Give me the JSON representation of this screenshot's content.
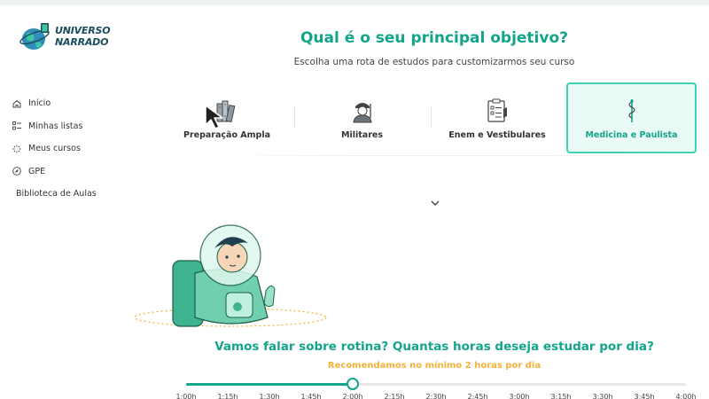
{
  "brand": {
    "line1": "Universo",
    "line2": "Narrado"
  },
  "sidebar": {
    "items": [
      {
        "label": "Início",
        "icon": "home-icon"
      },
      {
        "label": "Minhas listas",
        "icon": "list-icon"
      },
      {
        "label": "Meus cursos",
        "icon": "loader-icon"
      },
      {
        "label": "GPE",
        "icon": "compass-icon"
      },
      {
        "label": "Biblioteca de Aulas",
        "icon": ""
      }
    ]
  },
  "objective": {
    "title": "Qual é o seu principal objetivo?",
    "subtitle": "Escolha uma rota de estudos para customizarmos seu curso",
    "options": [
      {
        "label": "Preparação Ampla",
        "icon": "books-icon",
        "selected": false
      },
      {
        "label": "Militares",
        "icon": "soldier-icon",
        "selected": false
      },
      {
        "label": "Enem e Vestibulares",
        "icon": "checklist-icon",
        "selected": false
      },
      {
        "label": "Medicina e Paulista",
        "icon": "caduceus-icon",
        "selected": true
      }
    ]
  },
  "routine": {
    "title": "Vamos falar sobre rotina? Quantas horas deseja estudar por dia?",
    "recommendation": "Recomendamos no mínimo 2 horas por dia",
    "slider": {
      "value": "2:00h",
      "ticks": [
        "1:00h",
        "1:15h",
        "1:30h",
        "1:45h",
        "2:00h",
        "2:15h",
        "2:30h",
        "2:45h",
        "3:00h",
        "3:15h",
        "3:30h",
        "3:45h",
        "4:00h"
      ]
    }
  },
  "colors": {
    "accent": "#12a58a",
    "highlight": "#f7b13a",
    "selected_border": "#3dd2b5",
    "selected_bg": "#e9f9f5"
  }
}
